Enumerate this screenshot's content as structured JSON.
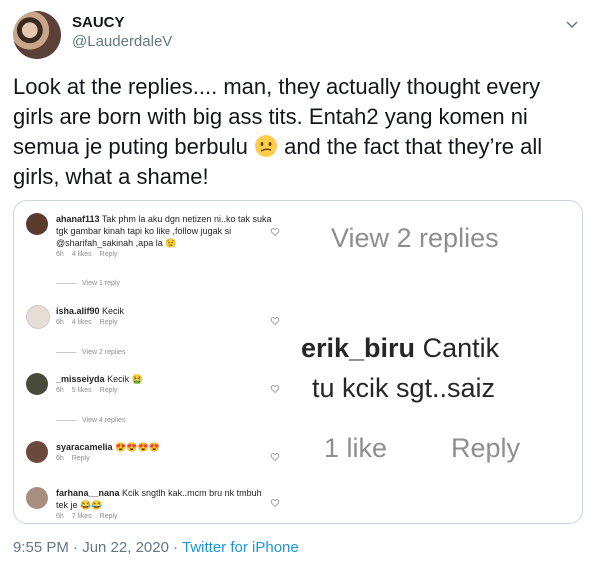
{
  "tweet": {
    "display_name": "SAUCY",
    "handle": "@LauderdaleV",
    "text_main": "Look at the replies.... man, they actually thought every girls are born with big ass tits. Entah2 yang komen ni semua je puting berbulu",
    "text_tail": "and the fact that they’re all girls, what a shame!",
    "timestamp": "9:55 PM · Jun 22, 2020 · ",
    "source": "Twitter for iPhone"
  },
  "screenshot": {
    "comments": [
      {
        "user": "ahanaf113",
        "text": "Tak phm la aku dgn netizen ni..ko tak suka tgk gambar kinah tapi ko like ,follow jugak si @sharifah_sakinah ,apa la",
        "time": "6h",
        "likes": "4 likes",
        "reply": "Reply"
      },
      {
        "user": "isha.alif90",
        "text": "Kecik",
        "time": "6h",
        "likes": "4 likes",
        "reply": "Reply"
      },
      {
        "user": "_misseiyda",
        "text": "Kecik",
        "time": "6h",
        "likes": "5 likes",
        "reply": "Reply"
      },
      {
        "user": "syaracamelia",
        "text": "",
        "time": "6h",
        "likes": "",
        "reply": "Reply"
      },
      {
        "user": "farhana__nana",
        "text": "Kcik sngtlh kak..mcm bru nk tmbuh tek je",
        "time": "6h",
        "likes": "7 likes",
        "reply": "Reply"
      }
    ],
    "view_lines": [
      "View 1 reply",
      "View 2 replies",
      "View 4 replies"
    ],
    "zoom": {
      "view_replies": "View 2 replies",
      "user": "erik_biru",
      "text1": "Cantik",
      "text2": "tu kcik sgt..saiz",
      "likes": "1 like",
      "reply": "Reply"
    }
  }
}
